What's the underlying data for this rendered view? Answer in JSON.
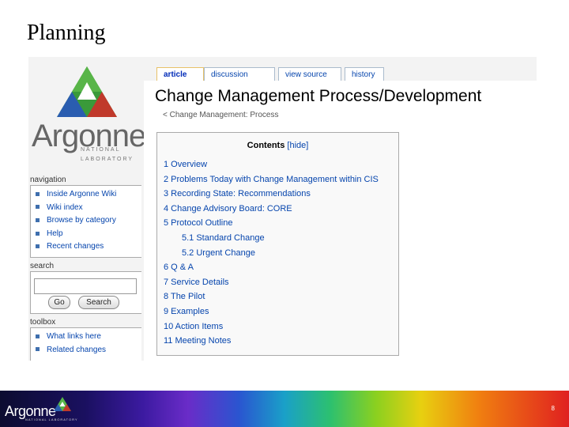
{
  "slide": {
    "title": "Planning",
    "page_number": "8"
  },
  "logo": {
    "word": "Argonne",
    "sub1": "NATIONAL",
    "sub2": "LABORATORY"
  },
  "tabs": [
    "article",
    "discussion",
    "view source",
    "history"
  ],
  "navigation": {
    "title": "navigation",
    "items": [
      "Inside Argonne Wiki",
      "Wiki index",
      "Browse by category",
      "Help",
      "Recent changes"
    ]
  },
  "search": {
    "title": "search",
    "go_label": "Go",
    "search_label": "Search",
    "value": ""
  },
  "toolbox": {
    "title": "toolbox",
    "items": [
      "What links here",
      "Related changes"
    ]
  },
  "page": {
    "heading": "Change Management Process/Development",
    "subpage": "< Change Management: Process"
  },
  "toc": {
    "title": "Contents",
    "hide": "[hide]",
    "items": [
      "1 Overview",
      "2 Problems Today with Change Management within CIS",
      "3 Recording State: Recommendations",
      "4 Change Advisory Board: CORE",
      "5 Protocol Outline",
      "5.1 Standard Change",
      "5.2 Urgent Change",
      "6 Q & A",
      "7 Service Details",
      "8 The Pilot",
      "9 Examples",
      "10 Action Items",
      "11 Meeting Notes"
    ]
  },
  "footer": {
    "logo_word": "Argonne",
    "logo_sub": "NATIONAL LABORATORY"
  },
  "colors": {
    "link": "#0645ad",
    "logo_green": "#4caf50",
    "logo_blue": "#2a5db0",
    "logo_red": "#c0392b"
  }
}
